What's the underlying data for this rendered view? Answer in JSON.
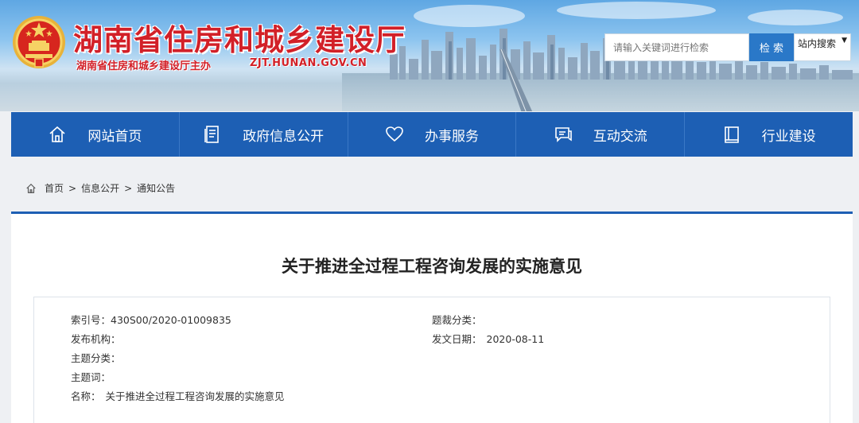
{
  "header": {
    "title": "湖南省住房和城乡建设厅",
    "subtitle": "湖南省住房和城乡建设厅主办",
    "domain": "ZJT.HUNAN.GOV.CN",
    "search_placeholder": "请输入关键词进行检索",
    "search_button": "检 索",
    "search_scope": "站内搜索",
    "brand_color": "#d22028"
  },
  "nav": {
    "items": [
      {
        "label": "网站首页",
        "icon": "home-icon"
      },
      {
        "label": "政府信息公开",
        "icon": "document-icon"
      },
      {
        "label": "办事服务",
        "icon": "heart-icon"
      },
      {
        "label": "互动交流",
        "icon": "chat-icon"
      },
      {
        "label": "行业建设",
        "icon": "book-icon"
      }
    ],
    "bg_color": "#1d5fb4"
  },
  "breadcrumb": {
    "icon": "home-icon",
    "items": [
      "首页",
      "信息公开",
      "通知公告"
    ],
    "separator": ">"
  },
  "article": {
    "title": "关于推进全过程工程咨询发展的实施意见",
    "meta": {
      "index_label": "索引号：",
      "index_value": "430S00/2020-01009835",
      "topic_class_label": "题裁分类：",
      "topic_class_value": "",
      "publisher_label": "发布机构：",
      "publisher_value": "",
      "date_label": "发文日期：",
      "date_value": "2020-08-11",
      "subject_label": "主题分类：",
      "subject_value": "",
      "keywords_label": "主题词：",
      "keywords_value": "",
      "name_label": "名称：",
      "name_value": "关于推进全过程工程咨询发展的实施意见"
    }
  }
}
